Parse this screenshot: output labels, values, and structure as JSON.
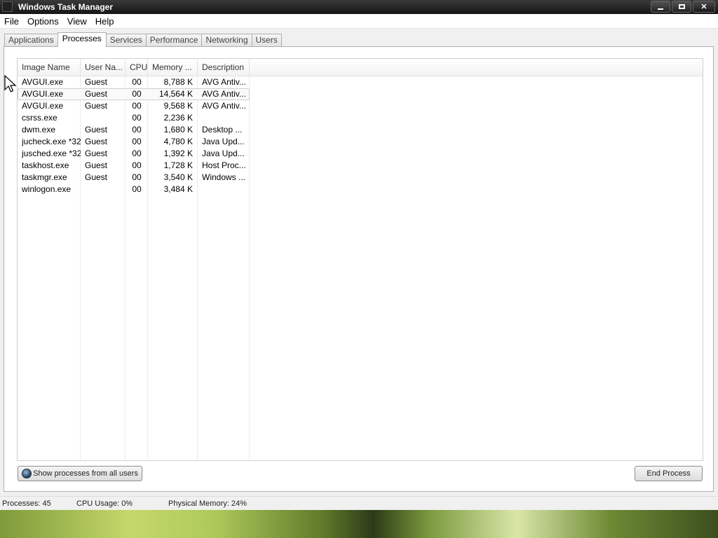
{
  "window": {
    "title": "Windows Task Manager",
    "buttons": {
      "minimize": "_",
      "maximize": "▭",
      "close": "✕"
    }
  },
  "menu": [
    "File",
    "Options",
    "View",
    "Help"
  ],
  "tabs": [
    {
      "label": "Applications",
      "active": false
    },
    {
      "label": "Processes",
      "active": true
    },
    {
      "label": "Services",
      "active": false
    },
    {
      "label": "Performance",
      "active": false
    },
    {
      "label": "Networking",
      "active": false
    },
    {
      "label": "Users",
      "active": false
    }
  ],
  "processes": {
    "columns": [
      "Image Name",
      "User Na...",
      "CPU",
      "Memory ...",
      "Description"
    ],
    "rows": [
      {
        "name": "AVGUI.exe",
        "user": "Guest",
        "cpu": "00",
        "memory": "8,788 K",
        "description": "AVG Antiv..."
      },
      {
        "name": "AVGUI.exe",
        "user": "Guest",
        "cpu": "00",
        "memory": "14,564 K",
        "description": "AVG Antiv...",
        "selected": true
      },
      {
        "name": "AVGUI.exe",
        "user": "Guest",
        "cpu": "00",
        "memory": "9,568 K",
        "description": "AVG Antiv..."
      },
      {
        "name": "csrss.exe",
        "user": "",
        "cpu": "00",
        "memory": "2,236 K",
        "description": ""
      },
      {
        "name": "dwm.exe",
        "user": "Guest",
        "cpu": "00",
        "memory": "1,680 K",
        "description": "Desktop ..."
      },
      {
        "name": "jucheck.exe *32",
        "user": "Guest",
        "cpu": "00",
        "memory": "4,780 K",
        "description": "Java Upd..."
      },
      {
        "name": "jusched.exe *32",
        "user": "Guest",
        "cpu": "00",
        "memory": "1,392 K",
        "description": "Java Upd..."
      },
      {
        "name": "taskhost.exe",
        "user": "Guest",
        "cpu": "00",
        "memory": "1,728 K",
        "description": "Host Proc..."
      },
      {
        "name": "taskmgr.exe",
        "user": "Guest",
        "cpu": "00",
        "memory": "3,540 K",
        "description": "Windows ..."
      },
      {
        "name": "winlogon.exe",
        "user": "",
        "cpu": "00",
        "memory": "3,484 K",
        "description": ""
      }
    ]
  },
  "buttons": {
    "show_all": "Show processes from all users",
    "end_process": "End Process"
  },
  "status": {
    "processes": "Processes: 45",
    "cpu": "CPU Usage: 0%",
    "memory": "Physical Memory: 24%"
  }
}
